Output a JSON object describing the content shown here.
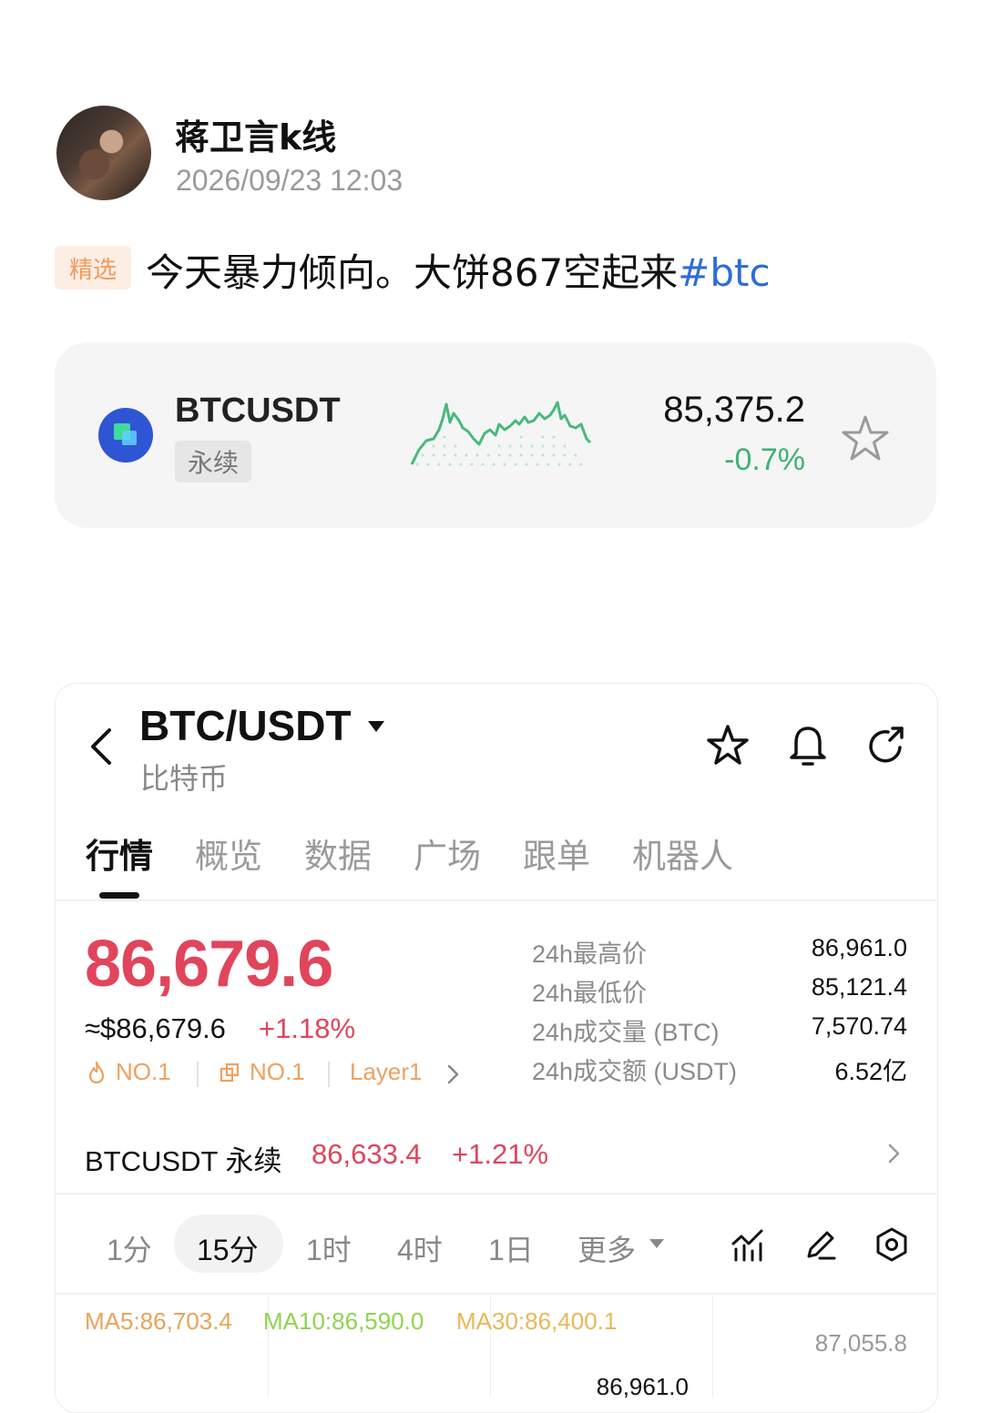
{
  "post": {
    "author": "蒋卫言k线",
    "time": "2026/09/23 12:03",
    "tag": "精选",
    "text": "今天暴力倾向。大饼867空起来",
    "hashtag": "#btc"
  },
  "ticker": {
    "symbol": "BTCUSDT",
    "badge": "永续",
    "price": "85,375.2",
    "change": "-0.7%",
    "change_color": "#3cb371"
  },
  "app": {
    "pair": "BTC/USDT",
    "subtitle": "比特币",
    "tabs": [
      "行情",
      "概览",
      "数据",
      "广场",
      "跟单",
      "机器人"
    ],
    "active_tab": "行情",
    "price": "86,679.6",
    "approx": "≈$86,679.6",
    "pct": "+1.18%",
    "up_color": "#e0455c",
    "ranks": [
      {
        "icon": "flame-icon",
        "label": "NO.1"
      },
      {
        "icon": "box-icon",
        "label": "NO.1"
      },
      {
        "icon": "",
        "label": "Layer1"
      }
    ],
    "stats": [
      {
        "label": "24h最高价",
        "value": "86,961.0"
      },
      {
        "label": "24h最低价",
        "value": "85,121.4"
      },
      {
        "label": "24h成交量 (BTC)",
        "value": "7,570.74"
      },
      {
        "label": "24h成交额 (USDT)",
        "value": "6.52亿"
      }
    ],
    "perp": {
      "label": "BTCUSDT 永续",
      "price": "86,633.4",
      "pct": "+1.21%"
    },
    "intervals": [
      "1分",
      "15分",
      "1时",
      "4时",
      "1日",
      "更多"
    ],
    "active_interval": "15分",
    "ma": {
      "ma5": "MA5:86,703.4",
      "ma10": "MA10:86,590.0",
      "ma30": "MA30:86,400.1"
    },
    "axis_price": "87,055.8",
    "chart_high_label": "86,961.0"
  }
}
